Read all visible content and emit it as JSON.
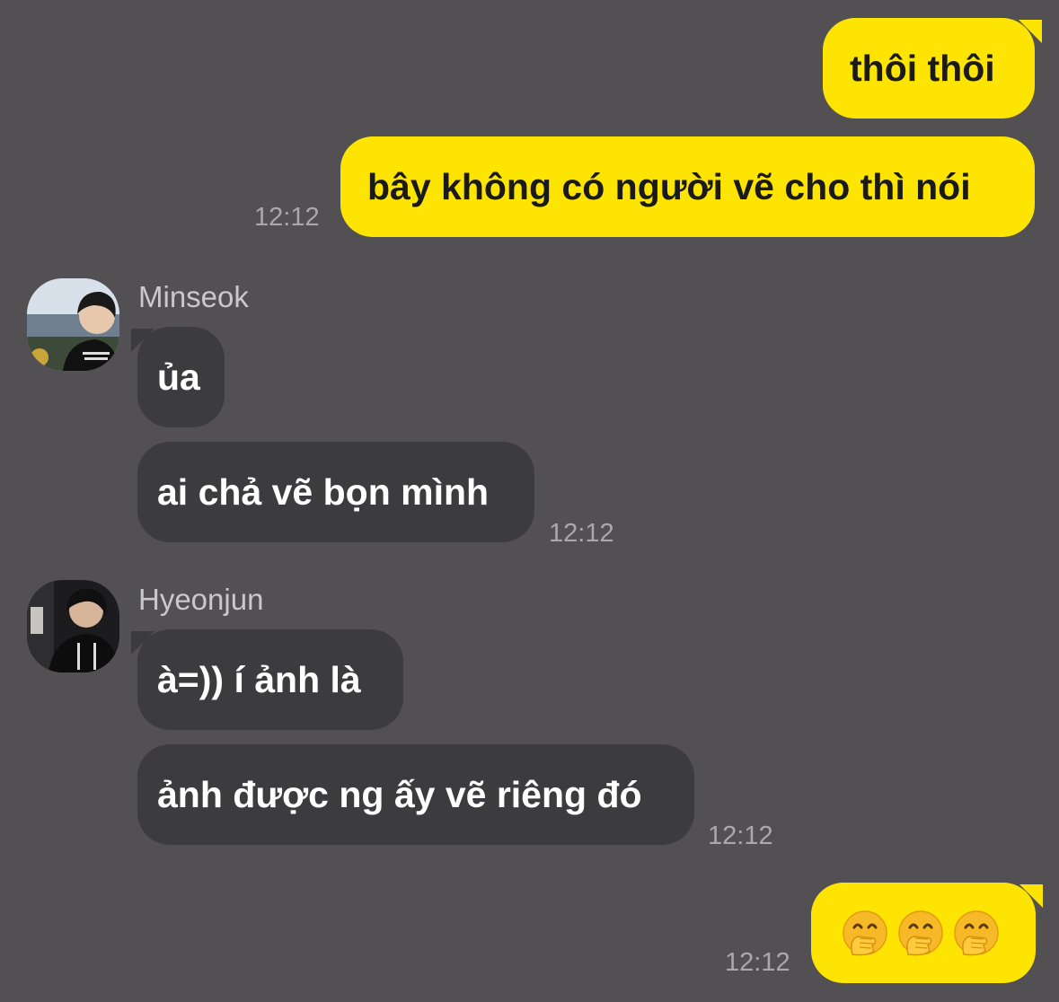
{
  "messages": {
    "m1": {
      "text": "thôi thôi"
    },
    "m2": {
      "text": "bây không có người vẽ cho thì nói",
      "time": "12:12"
    },
    "minseok": {
      "name": "Minseok",
      "m3": {
        "text": "ủa"
      },
      "m4": {
        "text": "ai chả vẽ bọn mình",
        "time": "12:12"
      }
    },
    "hyeonjun": {
      "name": "Hyeonjun",
      "m5": {
        "text": "à=)) í ảnh là"
      },
      "m6": {
        "text": "ảnh được ng ấy vẽ riêng đó",
        "time": "12:12"
      }
    },
    "m7": {
      "emojis": [
        "hand-over-mouth-emoji",
        "hand-over-mouth-emoji",
        "hand-over-mouth-emoji"
      ],
      "time": "12:12"
    }
  },
  "colors": {
    "background": "#525052",
    "outgoing_bubble": "#fde402",
    "incoming_bubble": "#3c3b3d",
    "timestamp": "#a9a8aa"
  }
}
